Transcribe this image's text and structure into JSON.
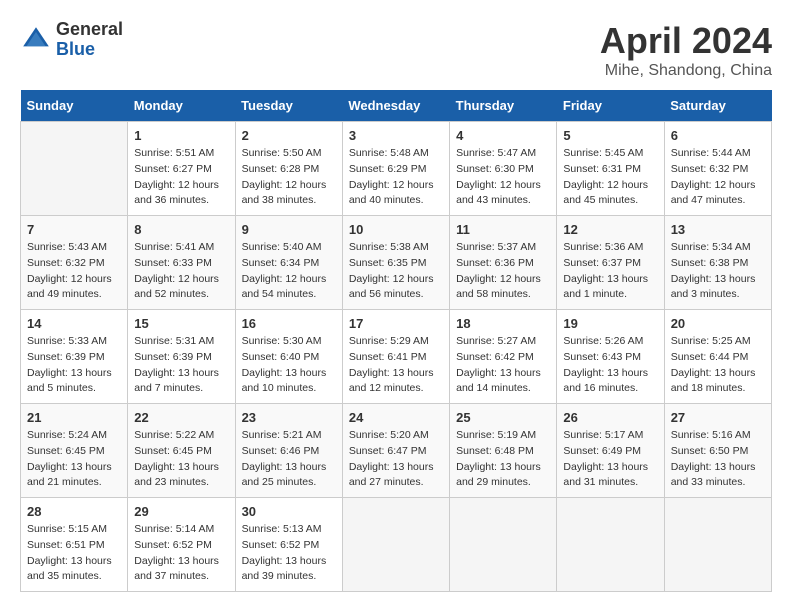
{
  "header": {
    "logo_general": "General",
    "logo_blue": "Blue",
    "title": "April 2024",
    "subtitle": "Mihe, Shandong, China"
  },
  "weekdays": [
    "Sunday",
    "Monday",
    "Tuesday",
    "Wednesday",
    "Thursday",
    "Friday",
    "Saturday"
  ],
  "weeks": [
    [
      {
        "day": "",
        "info": ""
      },
      {
        "day": "1",
        "info": "Sunrise: 5:51 AM\nSunset: 6:27 PM\nDaylight: 12 hours\nand 36 minutes."
      },
      {
        "day": "2",
        "info": "Sunrise: 5:50 AM\nSunset: 6:28 PM\nDaylight: 12 hours\nand 38 minutes."
      },
      {
        "day": "3",
        "info": "Sunrise: 5:48 AM\nSunset: 6:29 PM\nDaylight: 12 hours\nand 40 minutes."
      },
      {
        "day": "4",
        "info": "Sunrise: 5:47 AM\nSunset: 6:30 PM\nDaylight: 12 hours\nand 43 minutes."
      },
      {
        "day": "5",
        "info": "Sunrise: 5:45 AM\nSunset: 6:31 PM\nDaylight: 12 hours\nand 45 minutes."
      },
      {
        "day": "6",
        "info": "Sunrise: 5:44 AM\nSunset: 6:32 PM\nDaylight: 12 hours\nand 47 minutes."
      }
    ],
    [
      {
        "day": "7",
        "info": "Sunrise: 5:43 AM\nSunset: 6:32 PM\nDaylight: 12 hours\nand 49 minutes."
      },
      {
        "day": "8",
        "info": "Sunrise: 5:41 AM\nSunset: 6:33 PM\nDaylight: 12 hours\nand 52 minutes."
      },
      {
        "day": "9",
        "info": "Sunrise: 5:40 AM\nSunset: 6:34 PM\nDaylight: 12 hours\nand 54 minutes."
      },
      {
        "day": "10",
        "info": "Sunrise: 5:38 AM\nSunset: 6:35 PM\nDaylight: 12 hours\nand 56 minutes."
      },
      {
        "day": "11",
        "info": "Sunrise: 5:37 AM\nSunset: 6:36 PM\nDaylight: 12 hours\nand 58 minutes."
      },
      {
        "day": "12",
        "info": "Sunrise: 5:36 AM\nSunset: 6:37 PM\nDaylight: 13 hours\nand 1 minute."
      },
      {
        "day": "13",
        "info": "Sunrise: 5:34 AM\nSunset: 6:38 PM\nDaylight: 13 hours\nand 3 minutes."
      }
    ],
    [
      {
        "day": "14",
        "info": "Sunrise: 5:33 AM\nSunset: 6:39 PM\nDaylight: 13 hours\nand 5 minutes."
      },
      {
        "day": "15",
        "info": "Sunrise: 5:31 AM\nSunset: 6:39 PM\nDaylight: 13 hours\nand 7 minutes."
      },
      {
        "day": "16",
        "info": "Sunrise: 5:30 AM\nSunset: 6:40 PM\nDaylight: 13 hours\nand 10 minutes."
      },
      {
        "day": "17",
        "info": "Sunrise: 5:29 AM\nSunset: 6:41 PM\nDaylight: 13 hours\nand 12 minutes."
      },
      {
        "day": "18",
        "info": "Sunrise: 5:27 AM\nSunset: 6:42 PM\nDaylight: 13 hours\nand 14 minutes."
      },
      {
        "day": "19",
        "info": "Sunrise: 5:26 AM\nSunset: 6:43 PM\nDaylight: 13 hours\nand 16 minutes."
      },
      {
        "day": "20",
        "info": "Sunrise: 5:25 AM\nSunset: 6:44 PM\nDaylight: 13 hours\nand 18 minutes."
      }
    ],
    [
      {
        "day": "21",
        "info": "Sunrise: 5:24 AM\nSunset: 6:45 PM\nDaylight: 13 hours\nand 21 minutes."
      },
      {
        "day": "22",
        "info": "Sunrise: 5:22 AM\nSunset: 6:45 PM\nDaylight: 13 hours\nand 23 minutes."
      },
      {
        "day": "23",
        "info": "Sunrise: 5:21 AM\nSunset: 6:46 PM\nDaylight: 13 hours\nand 25 minutes."
      },
      {
        "day": "24",
        "info": "Sunrise: 5:20 AM\nSunset: 6:47 PM\nDaylight: 13 hours\nand 27 minutes."
      },
      {
        "day": "25",
        "info": "Sunrise: 5:19 AM\nSunset: 6:48 PM\nDaylight: 13 hours\nand 29 minutes."
      },
      {
        "day": "26",
        "info": "Sunrise: 5:17 AM\nSunset: 6:49 PM\nDaylight: 13 hours\nand 31 minutes."
      },
      {
        "day": "27",
        "info": "Sunrise: 5:16 AM\nSunset: 6:50 PM\nDaylight: 13 hours\nand 33 minutes."
      }
    ],
    [
      {
        "day": "28",
        "info": "Sunrise: 5:15 AM\nSunset: 6:51 PM\nDaylight: 13 hours\nand 35 minutes."
      },
      {
        "day": "29",
        "info": "Sunrise: 5:14 AM\nSunset: 6:52 PM\nDaylight: 13 hours\nand 37 minutes."
      },
      {
        "day": "30",
        "info": "Sunrise: 5:13 AM\nSunset: 6:52 PM\nDaylight: 13 hours\nand 39 minutes."
      },
      {
        "day": "",
        "info": ""
      },
      {
        "day": "",
        "info": ""
      },
      {
        "day": "",
        "info": ""
      },
      {
        "day": "",
        "info": ""
      }
    ]
  ]
}
